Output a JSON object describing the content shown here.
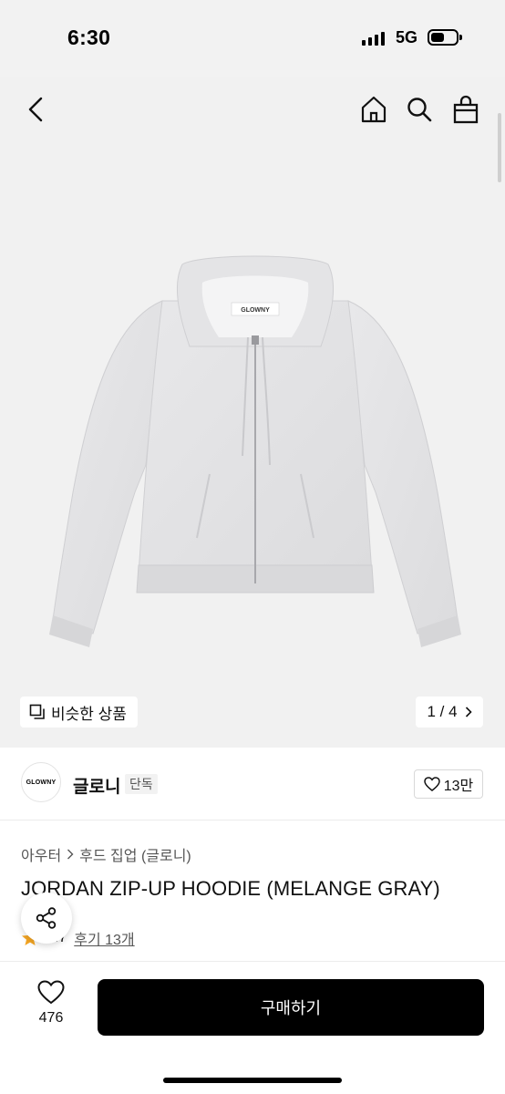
{
  "status_bar": {
    "time": "6:30",
    "network": "5G"
  },
  "header": {
    "back_icon": "chevron-left-icon",
    "home_icon": "home-icon",
    "search_icon": "search-icon",
    "bag_icon": "shopping-bag-icon"
  },
  "gallery": {
    "image_label": "GLOWNY",
    "similar_label": "비슷한 상품",
    "page_indicator": "1 / 4"
  },
  "brand": {
    "logo_text": "GLOWNY",
    "name": "글로니",
    "badge": "단독",
    "like_count": "13만"
  },
  "product": {
    "breadcrumb": [
      "아우터",
      "후드 집업 (글로니)"
    ],
    "title": "JORDAN ZIP-UP HOODIE (MELANGE GRAY)",
    "rating": "4.7",
    "review_link": "후기 13개"
  },
  "bottom_bar": {
    "wish_count": "476",
    "buy_label": "구매하기"
  },
  "colors": {
    "hero_bg": "#f1f1f1",
    "buy_button": "#000000",
    "star": "#f5a623",
    "hoodie": "#e2e2e4"
  }
}
